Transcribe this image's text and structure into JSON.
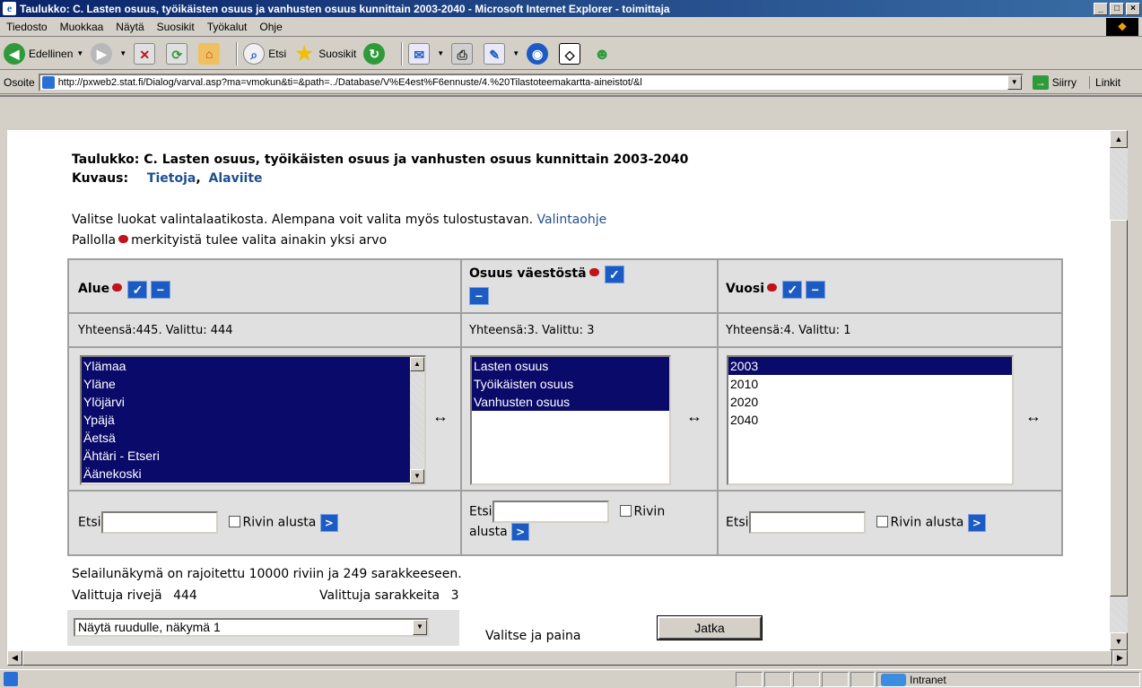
{
  "window": {
    "title": "Taulukko: C. Lasten osuus, työikäisten osuus ja vanhusten osuus kunnittain 2003-2040 - Microsoft Internet Explorer - toimittaja"
  },
  "menu": [
    "Tiedosto",
    "Muokkaa",
    "Näytä",
    "Suosikit",
    "Työkalut",
    "Ohje"
  ],
  "toolbar": {
    "back": "Edellinen",
    "search": "Etsi",
    "favorites": "Suosikit"
  },
  "address": {
    "label": "Osoite",
    "url": "http://pxweb2.stat.fi/Dialog/varval.asp?ma=vmokun&ti=&path=../Database/V%E4est%F6ennuste/4.%20Tilastoteemakartta-aineistot/&l",
    "go": "Siirry",
    "links": "Linkit"
  },
  "page": {
    "title": "Taulukko: C. Lasten osuus, työikäisten osuus ja vanhusten osuus kunnittain 2003-2040",
    "desc_label": "Kuvaus:",
    "desc_link1": "Tietoja",
    "desc_link2": "Alaviite",
    "intro": "Valitse luokat valintalaatikosta. Alempana voit valita myös tulostustavan.",
    "intro_link": "Valintaohje",
    "required_pre": "Pallolla",
    "required_post": "merkityistä tulee valita ainakin yksi arvo",
    "limit": "Selailunäkymä on rajoitettu 10000 riviin ja 249 sarakkeeseen.",
    "rows_label": "Valittuja rivejä",
    "rows_value": "444",
    "cols_label": "Valittuja sarakkeita",
    "cols_value": "3",
    "output_option": "Näytä ruudulle, näkymä 1",
    "pick_label": "Valitse ja paina",
    "continue": "Jatka"
  },
  "variables": [
    {
      "name": "Alue",
      "count_label": "Yhteensä:445. Valittu:",
      "count_value": "444",
      "options": [
        {
          "label": "Ylämaa",
          "selected": true
        },
        {
          "label": "Yläne",
          "selected": true
        },
        {
          "label": "Ylöjärvi",
          "selected": true
        },
        {
          "label": "Ypäjä",
          "selected": true
        },
        {
          "label": "Äetsä",
          "selected": true
        },
        {
          "label": "Ähtäri - Etseri",
          "selected": true
        },
        {
          "label": "Äänekoski",
          "selected": true
        }
      ]
    },
    {
      "name": "Osuus väestöstä",
      "count_label": "Yhteensä:3. Valittu:",
      "count_value": "3",
      "options": [
        {
          "label": "Lasten osuus",
          "selected": true
        },
        {
          "label": "Työikäisten osuus",
          "selected": true
        },
        {
          "label": "Vanhusten osuus",
          "selected": true
        }
      ]
    },
    {
      "name": "Vuosi",
      "count_label": "Yhteensä:4. Valittu:",
      "count_value": "1",
      "options": [
        {
          "label": "2003",
          "selected": true
        },
        {
          "label": "2010",
          "selected": false
        },
        {
          "label": "2020",
          "selected": false
        },
        {
          "label": "2040",
          "selected": false
        }
      ]
    }
  ],
  "search": {
    "label": "Etsi",
    "from_start": "Rivin alusta",
    "from_start_1": "Rivin",
    "from_start_2": "alusta"
  },
  "status": {
    "zone": "Intranet"
  }
}
